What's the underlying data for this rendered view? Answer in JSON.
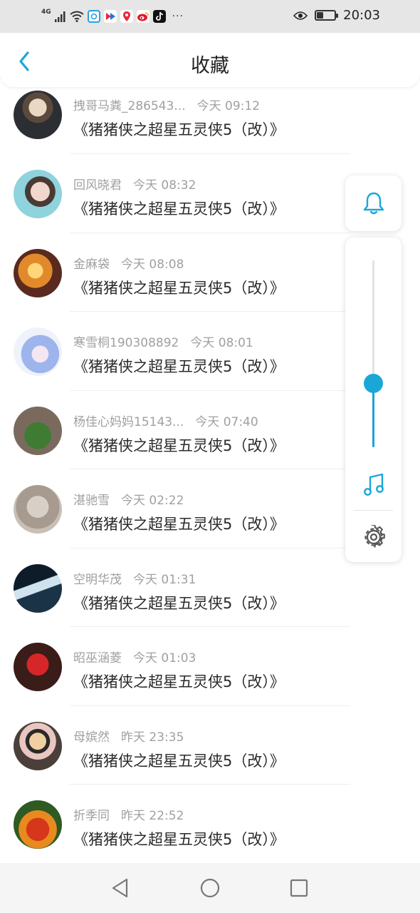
{
  "status_bar": {
    "network": "4G",
    "time": "20:03",
    "more": "···",
    "app_icons": [
      "browser-icon",
      "video-app-icon",
      "map-pin-app-icon",
      "weibo-icon",
      "tiktok-icon"
    ]
  },
  "header": {
    "title": "收藏"
  },
  "colors": {
    "accent": "#1aa7d8",
    "text_primary": "#2a2a2a",
    "text_secondary": "#a0a0a0"
  },
  "favorites": [
    {
      "name": "拽哥马粪_286543...",
      "time": "今天 09:12",
      "message": "《猪猪侠之超星五灵侠5（改）》"
    },
    {
      "name": "回风晓君",
      "time": "今天 08:32",
      "message": "《猪猪侠之超星五灵侠5（改）》"
    },
    {
      "name": "金麻袋",
      "time": "今天 08:08",
      "message": "《猪猪侠之超星五灵侠5（改）》"
    },
    {
      "name": "寒雪桐190308892",
      "time": "今天 08:01",
      "message": "《猪猪侠之超星五灵侠5（改）》"
    },
    {
      "name": "杨佳心妈妈15143...",
      "time": "今天 07:40",
      "message": "《猪猪侠之超星五灵侠5（改）》"
    },
    {
      "name": "湛驰雪",
      "time": "今天 02:22",
      "message": "《猪猪侠之超星五灵侠5（改）》"
    },
    {
      "name": "空明华茂",
      "time": "今天 01:31",
      "message": "《猪猪侠之超星五灵侠5（改）》"
    },
    {
      "name": "昭巫涵菱",
      "time": "今天 01:03",
      "message": "《猪猪侠之超星五灵侠5（改）》"
    },
    {
      "name": "母嫔然",
      "time": "昨天 23:35",
      "message": "《猪猪侠之超星五灵侠5（改）》"
    },
    {
      "name": "折季同",
      "time": "昨天 22:52",
      "message": "《猪猪侠之超星五灵侠5（改）》"
    }
  ],
  "volume_panel": {
    "level": 0.34,
    "icons": [
      "bell-icon",
      "music-note-icon",
      "gear-icon"
    ]
  },
  "nav_bar": {
    "buttons": [
      "back-triangle-icon",
      "home-circle-icon",
      "recents-square-icon"
    ]
  }
}
